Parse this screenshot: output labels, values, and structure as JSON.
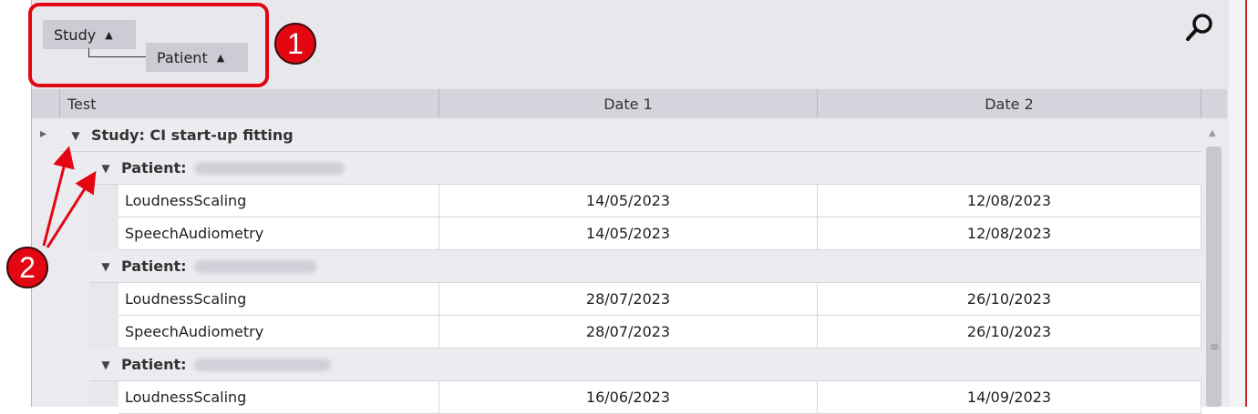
{
  "group_panel": {
    "chips": [
      {
        "label": "Study",
        "sort": "▲"
      },
      {
        "label": "Patient",
        "sort": "▲"
      }
    ]
  },
  "callouts": [
    "1",
    "2"
  ],
  "columns": [
    "Test",
    "Date 1",
    "Date 2"
  ],
  "study_group": {
    "expander": "▼",
    "label": "Study: CI start-up fitting"
  },
  "patients": [
    {
      "expander": "▼",
      "label": "Patient:",
      "rows": [
        {
          "test": "LoudnessScaling",
          "date1": "14/05/2023",
          "date2": "12/08/2023"
        },
        {
          "test": "SpeechAudiometry",
          "date1": "14/05/2023",
          "date2": "12/08/2023"
        }
      ]
    },
    {
      "expander": "▼",
      "label": "Patient:",
      "rows": [
        {
          "test": "LoudnessScaling",
          "date1": "28/07/2023",
          "date2": "26/10/2023"
        },
        {
          "test": "SpeechAudiometry",
          "date1": "28/07/2023",
          "date2": "26/10/2023"
        }
      ]
    },
    {
      "expander": "▼",
      "label": "Patient:",
      "rows": [
        {
          "test": "LoudnessScaling",
          "date1": "16/06/2023",
          "date2": "14/09/2023"
        }
      ]
    }
  ],
  "row_indicator": "▸",
  "scrollbar": {
    "up": "▲",
    "grip": "≡"
  },
  "colors": {
    "callout_red": "#e30613",
    "header_bg": "#d3d4dc",
    "group_bg": "#ececf0"
  }
}
